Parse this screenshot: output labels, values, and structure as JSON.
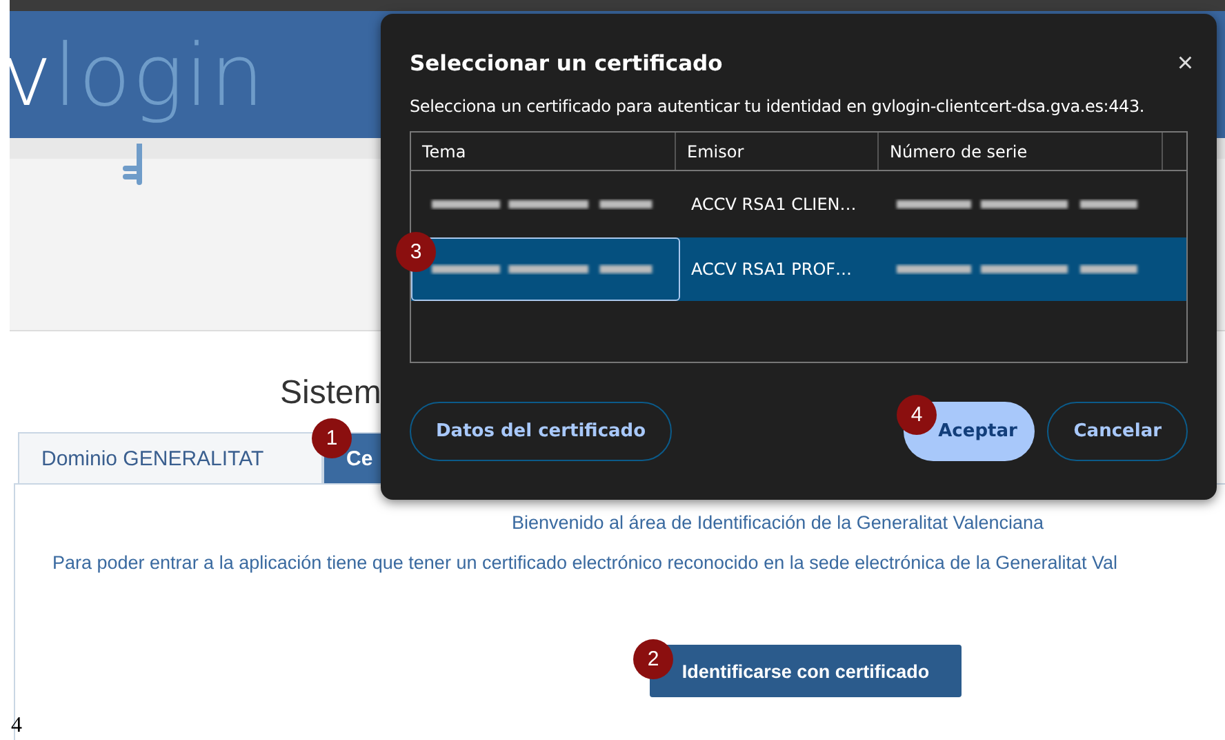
{
  "page": {
    "logo": {
      "prefix": "v",
      "name": "login"
    },
    "title": "Sistem",
    "tabs": [
      {
        "label": "Dominio GENERALITAT",
        "selected": false
      },
      {
        "label": "Ce",
        "selected": true
      }
    ],
    "welcome": "Bienvenido al área de Identificación de la Generalitat Valenciana",
    "instructions": "Para poder entrar a la aplicación tiene que tener un certificado electrónico reconocido en la sede electrónica de la Generalitat Val",
    "primary_button": "Identificarse con certificado",
    "page_number": "4"
  },
  "dialog": {
    "title": "Seleccionar un certificado",
    "close": "×",
    "message": "Selecciona un certificado para autenticar tu identidad en gvlogin-clientcert-dsa.gva.es:443.",
    "columns": [
      "Tema",
      "Emisor",
      "Número de serie"
    ],
    "rows": [
      {
        "issuer": "ACCV RSA1 CLIEN…",
        "selected": false
      },
      {
        "issuer": "ACCV RSA1 PROF…",
        "selected": true
      }
    ],
    "buttons": [
      {
        "label": "Datos del certificado",
        "kind": "secondary"
      },
      {
        "label": "Aceptar",
        "kind": "primary"
      },
      {
        "label": "Cancelar",
        "kind": "secondary"
      }
    ]
  },
  "callouts": [
    {
      "label": "1"
    },
    {
      "label": "2"
    },
    {
      "label": "3"
    },
    {
      "label": "4"
    }
  ]
}
